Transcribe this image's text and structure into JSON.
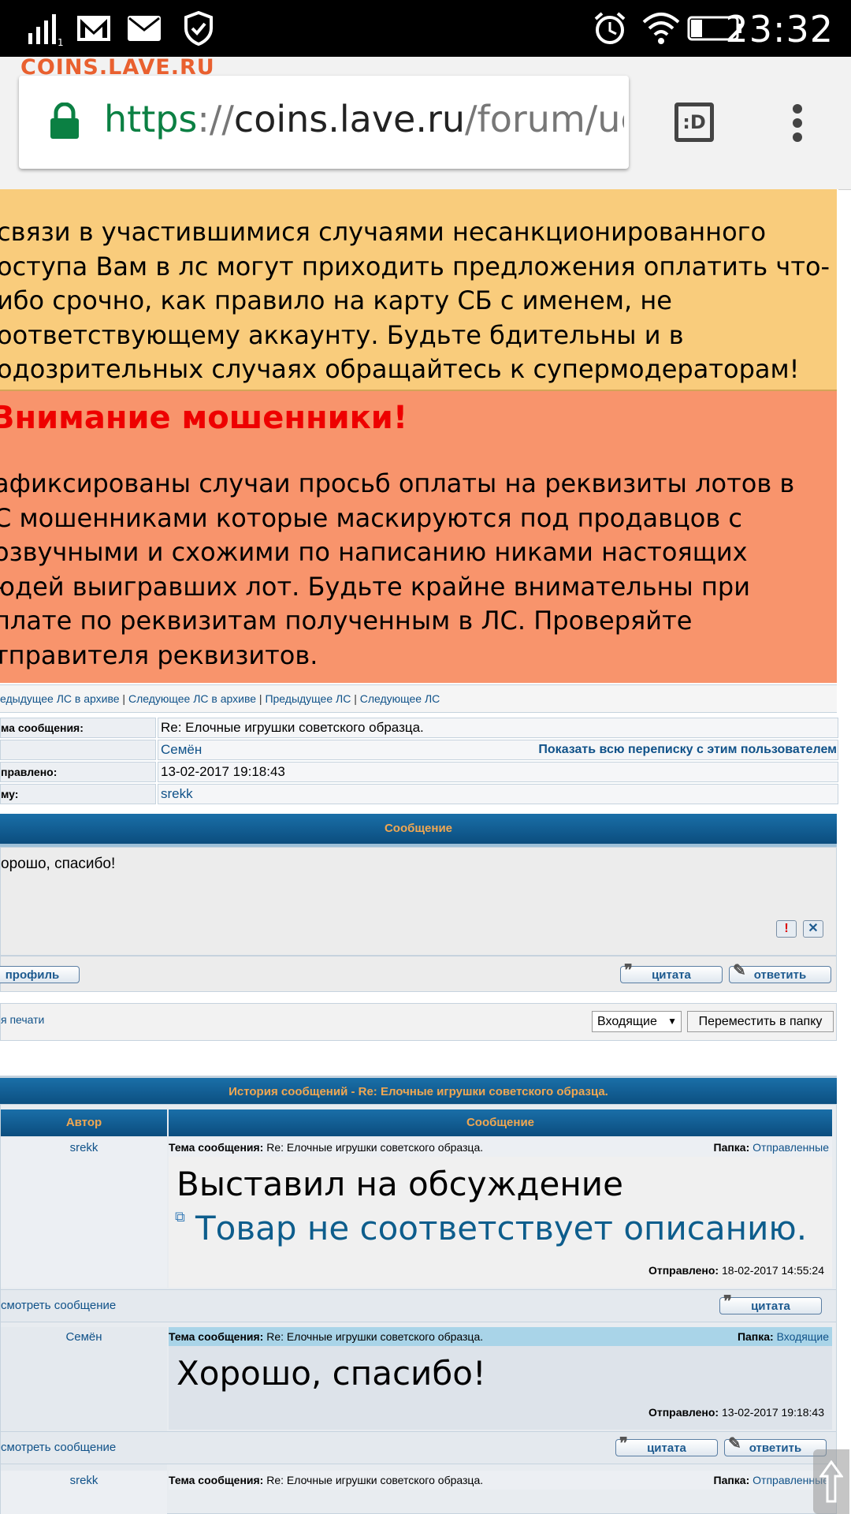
{
  "status_bar": {
    "time": "23:32",
    "icons": [
      "signal-icon",
      "gmail-icon",
      "mail-icon",
      "shield-icon",
      "alarm-icon",
      "wifi-icon",
      "battery-icon"
    ]
  },
  "watermark": "COINS.LAVE.RU",
  "browser": {
    "url_scheme": "https",
    "url_sep": "://",
    "url_host": "coins.lave.ru",
    "url_path": "/forum/ucp.pl",
    "tab_badge": ":D"
  },
  "notice_yellow": {
    "lines": [
      "связи в участившимися случаями несанкционированного",
      "оступа Вам в лс могут приходить предложения оплатить что-",
      "ибо срочно, как правило на карту СБ с именем, не",
      "оответствующему аккаунту. Будьте бдительны и в",
      "одозрительных случаях обращайтесь к супермодераторам!"
    ]
  },
  "notice_red": {
    "title": "Внимание мошенники!",
    "lines": [
      "афиксированы случаи просьб оплаты на реквизиты лотов в",
      "С мошенниками которые маскируются под продавцов с",
      "озвучными и схожими по написанию никами настоящих",
      "юдей выигравших лот. Будьте крайне внимательны при",
      "плате по реквизитам полученным в ЛС. Проверяйте",
      "тправителя реквизитов."
    ]
  },
  "nav": {
    "prev_archive": "едыдущее ЛС в архиве",
    "next_archive": "Следующее ЛС в архиве",
    "prev": "Предыдущее ЛС",
    "next": "Следующее ЛС",
    "sep": " | "
  },
  "header": {
    "subject_label": "ма сообщения:",
    "subject_value": "Re: Елочные игрушки советского образца.",
    "from_value": "Семён",
    "show_all": "Показать всю переписку с этим пользователем",
    "sent_label": "правлено:",
    "sent_value": "13-02-2017 19:18:43",
    "to_label": "му:",
    "to_value": "srekk"
  },
  "message": {
    "bar_title": "Сообщение",
    "body": "орошо, спасибо!",
    "profile_btn": "профиль",
    "quote_btn": "цитата",
    "reply_btn": "ответить"
  },
  "folder_row": {
    "print_link": "я печати",
    "select_value": "Входящие",
    "move_btn": "Переместить в папку"
  },
  "history": {
    "title": "История сообщений - Re: Елочные игрушки советского образца.",
    "col_author": "Автор",
    "col_message": "Сообщение",
    "subject_label": "Тема сообщения:",
    "folder_label": "Папка:",
    "sent_label": "Отправлено:",
    "view_link": "смотреть сообщение",
    "quote_btn": "цитата",
    "reply_btn": "ответить",
    "items": [
      {
        "author": "srekk",
        "subject": "Re: Елочные игрушки советского образца.",
        "folder": "Отправленные",
        "line1": "Выставил на обсуждение",
        "link": "Товар не соответствует описанию.",
        "sent": "18-02-2017 14:55:24"
      },
      {
        "author": "Семён",
        "subject": "Re: Елочные игрушки советского образца.",
        "folder": "Входящие",
        "line1": "Хорошо, спасибо!",
        "sent": "13-02-2017 19:18:43"
      },
      {
        "author": "srekk",
        "subject": "Re: Елочные игрушки советского образца.",
        "folder": "Отправленные"
      }
    ]
  }
}
